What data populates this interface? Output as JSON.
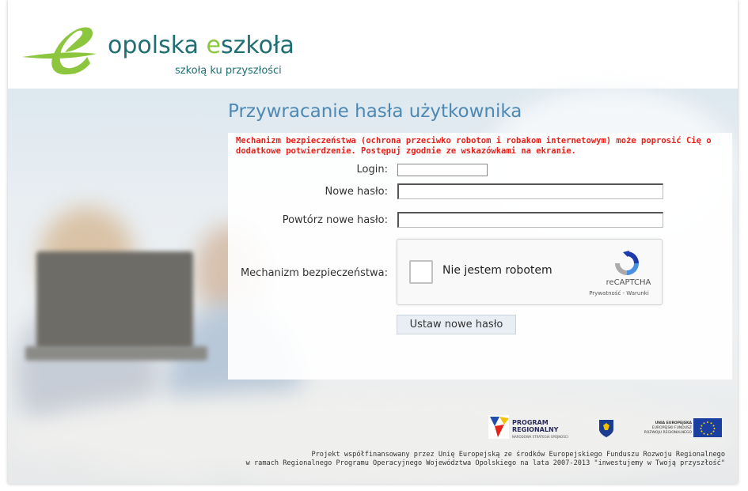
{
  "brand": {
    "name_part1": "opolska ",
    "name_part2": "e",
    "name_part3": "szkoła",
    "tagline": "szkołą ku przyszłości"
  },
  "form": {
    "title": "Przywracanie hasła użytkownika",
    "warning": "Mechanizm bezpieczeństwa (ochrona przeciwko robotom i robakom internetowym) może poprosić Cię o dodatkowe potwierdzenie. Postępuj zgodnie ze wskazówkami na ekranie.",
    "login_label": "Login:",
    "login_value": "",
    "new_password_label": "Nowe hasło:",
    "repeat_password_label": "Powtórz nowe hasło:",
    "security_label": "Mechanizm bezpieczeństwa:",
    "submit_label": "Ustaw nowe hasło"
  },
  "recaptcha": {
    "checkbox_label": "Nie jestem robotem",
    "brand": "reCAPTCHA",
    "links": "Prywatność - Warunki"
  },
  "footer": {
    "program_line1": "PROGRAM",
    "program_line2": "REGIONALNY",
    "program_sub": "NARODOWA STRATEGIA SPÓJNOŚCI",
    "eu_line1": "UNIA EUROPEJSKA",
    "eu_line2": "EUROPEJSKI FUNDUSZ",
    "eu_line3": "ROZWOJU REGIONALNEGO",
    "funding_line1": "Projekt współfinansowany przez Unię Europejską ze środków Europejskiego Funduszu Rozwoju Regionalnego",
    "funding_line2": "w ramach Regionalnego Programu Operacyjnego Województwa Opolskiego na lata 2007-2013 \"inwestujemy w Twoją przyszłość\""
  },
  "colors": {
    "brand_teal": "#1f6e72",
    "brand_green": "#8cc63e",
    "title_blue": "#4e89b3",
    "warning_red": "#e8201a"
  },
  "icons": [
    "logo-e-swoosh",
    "recaptcha-logo",
    "program-regionalny-logo",
    "opolskie-crest",
    "eu-flag"
  ]
}
